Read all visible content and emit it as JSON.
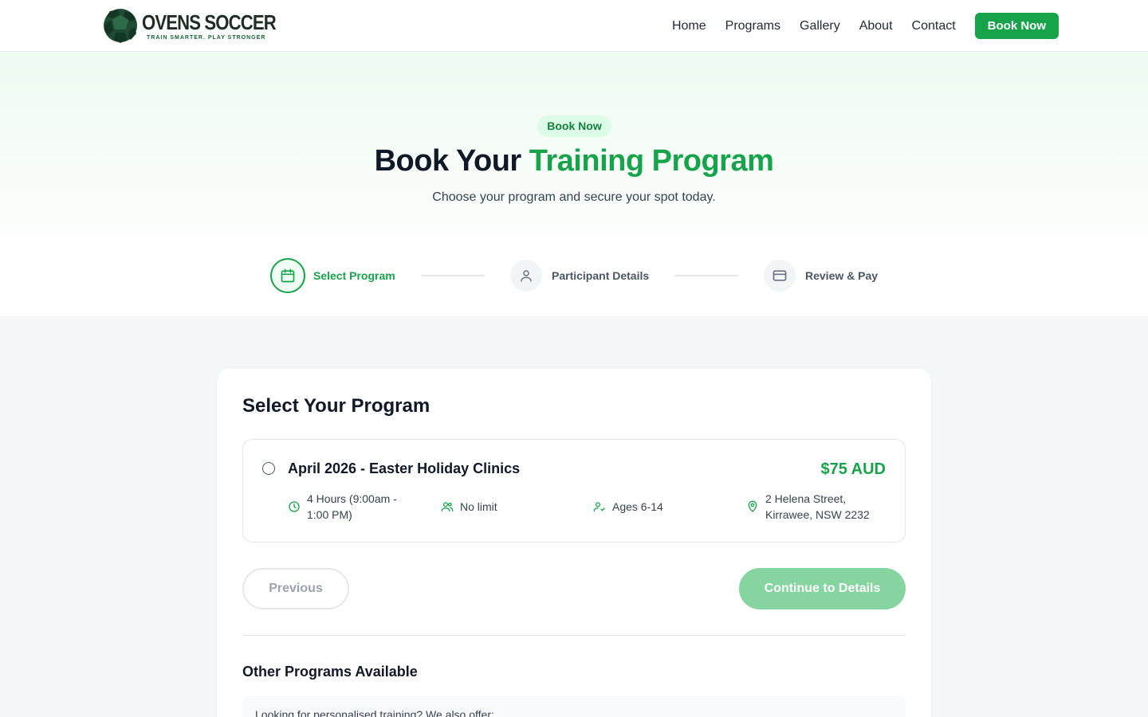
{
  "brand": {
    "name": "OVENS SOCCER",
    "tagline": "TRAIN SMARTER. PLAY STRONGER",
    "primary_color": "#16a34a",
    "dark_color": "#1f2d26"
  },
  "nav": {
    "items": [
      "Home",
      "Programs",
      "Gallery",
      "About",
      "Contact"
    ],
    "cta": "Book Now"
  },
  "hero": {
    "pill": "Book Now",
    "title_main": "Book Your ",
    "title_accent": "Training Program",
    "subtitle": "Choose your program and secure your spot today."
  },
  "stepper": {
    "steps": [
      {
        "label": "Select Program",
        "icon": "calendar-icon",
        "state": "active"
      },
      {
        "label": "Participant Details",
        "icon": "user-icon",
        "state": "inactive"
      },
      {
        "label": "Review & Pay",
        "icon": "credit-card-icon",
        "state": "inactive"
      }
    ]
  },
  "booking": {
    "heading": "Select Your Program",
    "program": {
      "title": "April 2026 - Easter Holiday Clinics",
      "price": "$75 AUD",
      "duration": "4 Hours (9:00am - 1:00 PM)",
      "capacity": "No limit",
      "ages": "Ages 6-14",
      "location": "2 Helena Street, Kirrawee, NSW 2232",
      "selected": false
    },
    "previous_label": "Previous",
    "continue_label": "Continue to Details",
    "other_heading": "Other Programs Available",
    "other_text": "Looking for personalised training? We also offer:"
  }
}
